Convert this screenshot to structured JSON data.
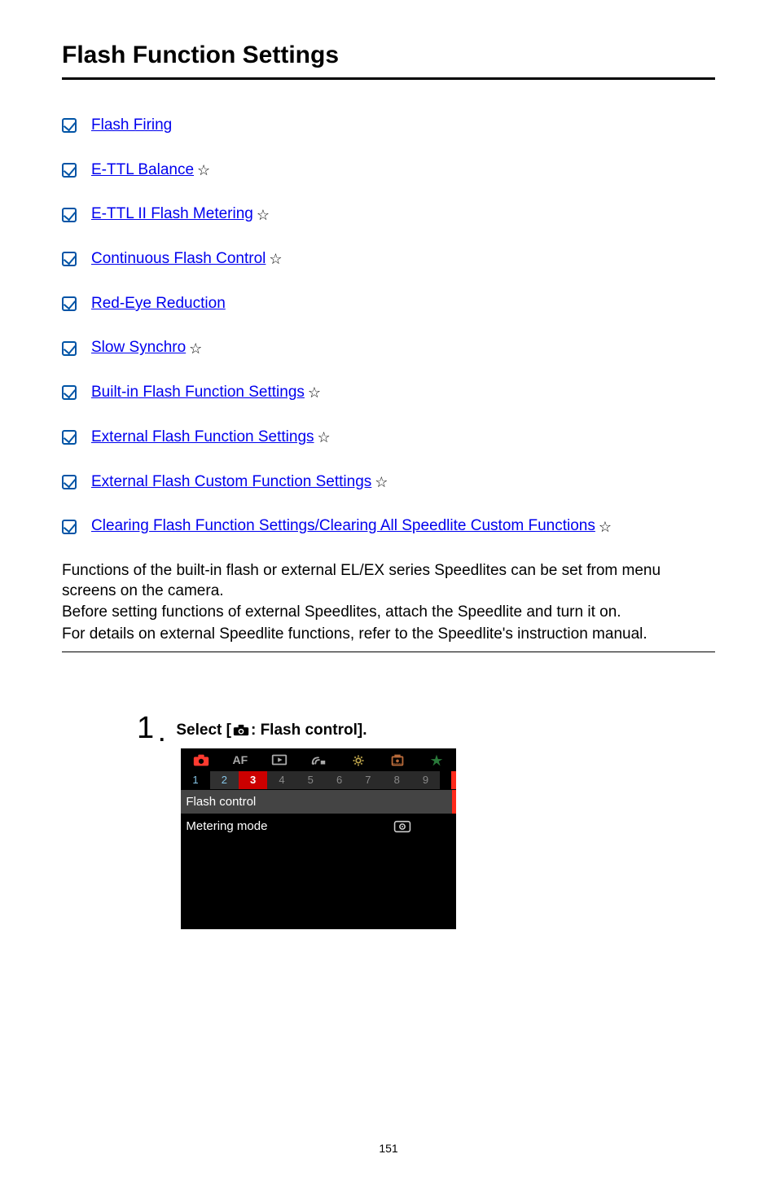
{
  "title": "Flash Function Settings",
  "links": [
    {
      "label": "Flash Firing",
      "star": false
    },
    {
      "label": "E-TTL Balance",
      "star": true
    },
    {
      "label": "E-TTL II Flash Metering",
      "star": true
    },
    {
      "label": "Continuous Flash Control",
      "star": true
    },
    {
      "label": "Red-Eye Reduction",
      "star": false
    },
    {
      "label": "Slow Synchro",
      "star": true
    },
    {
      "label": "Built-in Flash Function Settings",
      "star": true
    },
    {
      "label": "External Flash Function Settings",
      "star": true
    },
    {
      "label": "External Flash Custom Function Settings",
      "star": true
    },
    {
      "label": "Clearing Flash Function Settings/Clearing All Speedlite Custom Functions",
      "star": true
    }
  ],
  "body": {
    "p1": "Functions of the built-in flash or external EL/EX series Speedlites can be set from menu screens on the camera.",
    "p2": "Before setting functions of external Speedlites, attach the Speedlite and turn it on.",
    "p3": "For details on external Speedlite functions, refer to the Speedlite's instruction manual."
  },
  "step": {
    "number": "1",
    "dot": ".",
    "prefix": "Select [",
    "suffix": ": Flash control]."
  },
  "menu": {
    "tabs": [
      "camera",
      "AF",
      "play",
      "wifi",
      "wrench",
      "cog",
      "star"
    ],
    "subtabs": [
      "1",
      "2",
      "3",
      "4",
      "5",
      "6",
      "7",
      "8",
      "9",
      ""
    ],
    "active_sub": "3",
    "rows": [
      {
        "label": "Flash control",
        "value": "",
        "selected": true
      },
      {
        "label": "Metering mode",
        "value": "evaluative",
        "selected": false
      }
    ]
  },
  "page_number": "151"
}
